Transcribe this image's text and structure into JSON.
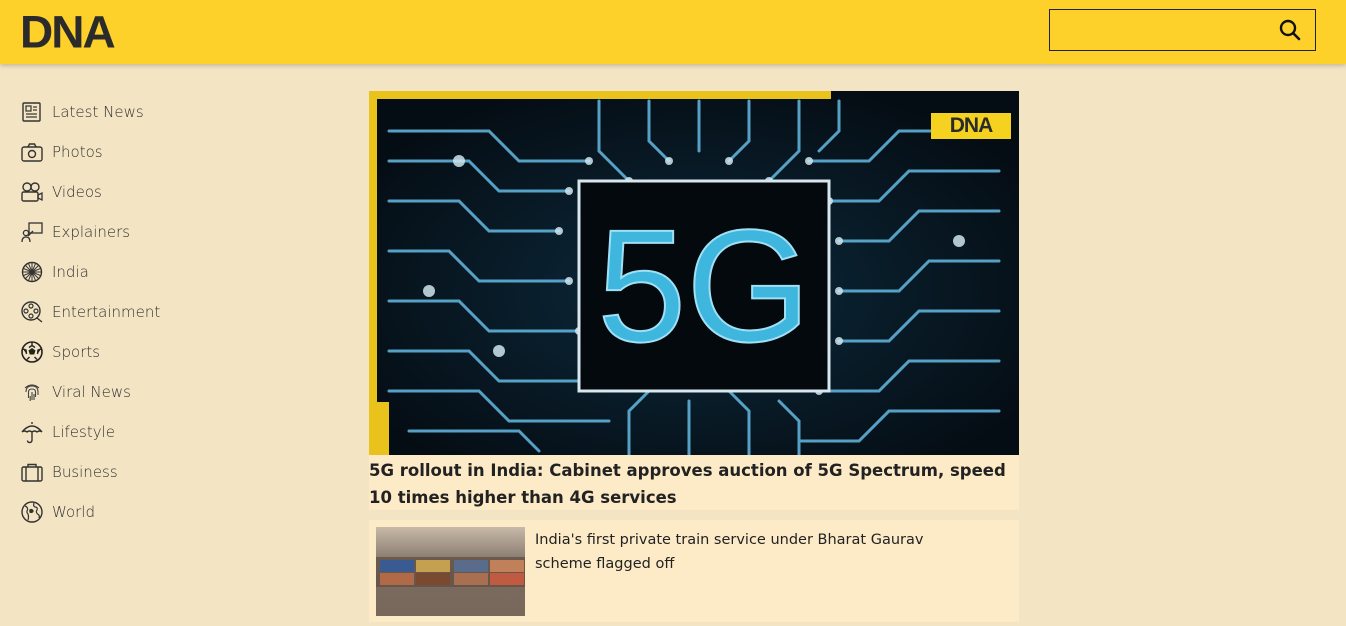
{
  "header": {
    "logo": "DNA",
    "search": {
      "value": "",
      "placeholder": ""
    },
    "brand_color": "#fdd02a"
  },
  "sidebar": {
    "items": [
      {
        "label": "Latest News",
        "icon": "newspaper-icon"
      },
      {
        "label": "Photos",
        "icon": "camera-icon"
      },
      {
        "label": "Videos",
        "icon": "video-camera-icon"
      },
      {
        "label": "Explainers",
        "icon": "presenter-icon"
      },
      {
        "label": "India",
        "icon": "ashoka-chakra-icon"
      },
      {
        "label": "Entertainment",
        "icon": "film-reel-icon"
      },
      {
        "label": "Sports",
        "icon": "football-icon"
      },
      {
        "label": "Viral News",
        "icon": "fingerprint-icon"
      },
      {
        "label": "Lifestyle",
        "icon": "umbrella-icon"
      },
      {
        "label": "Business",
        "icon": "briefcase-icon"
      },
      {
        "label": "World",
        "icon": "globe-icon"
      }
    ]
  },
  "main": {
    "hero": {
      "image_text": "5G",
      "badge": "DNA",
      "title": "5G rollout in India: Cabinet approves auction of 5G Spectrum, speed 10 times higher than 4G services"
    },
    "stories": [
      {
        "title": "India's first private train service under Bharat Gaurav scheme flagged off"
      }
    ]
  }
}
